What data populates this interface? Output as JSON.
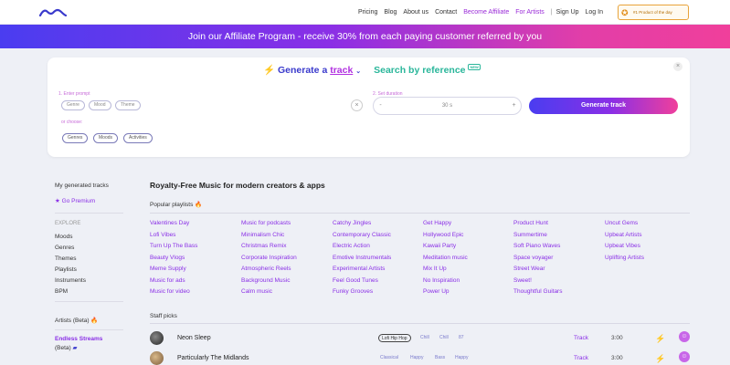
{
  "nav": {
    "links": [
      "Pricing",
      "Blog",
      "About us",
      "Contact",
      "Become Affiliate",
      "For Artists",
      "Sign Up",
      "Log In"
    ],
    "badge_text": "#1 Product of the day"
  },
  "banner": {
    "text": "Join our Affiliate Program - receive 30% from each paying customer referred by you"
  },
  "generator": {
    "tab_generate_prefix": "Generate a",
    "tab_generate_word": "track",
    "tab_reference": "Search by reference",
    "tab_reference_badge": "NEW",
    "label_prompt": "1. Enter prompt",
    "prompt_chips": [
      "Genre",
      "Mood",
      "Theme"
    ],
    "label_choose": "or choose:",
    "choose_chips": [
      "Genres",
      "Moods",
      "Activities"
    ],
    "label_duration": "2. Set duration",
    "duration_value": "30 s",
    "decrease": "-",
    "increase": "+",
    "generate_button": "Generate track",
    "close": "×"
  },
  "sidebar": {
    "my_tracks": "My generated tracks",
    "go_premium": "Go Premium",
    "explore": "EXPLORE",
    "explore_items": [
      "Moods",
      "Genres",
      "Themes",
      "Playlists",
      "Instruments",
      "BPM"
    ],
    "artists": "Artists (Beta)",
    "endless": "Endless Streams",
    "endless_sub": "(Beta)"
  },
  "main": {
    "title": "Royalty-Free Music for modern creators & apps",
    "popular": "Popular playlists",
    "playlists": [
      [
        "Valentines Day",
        "Lofi Vibes",
        "Turn Up The Bass",
        "Beauty Vlogs",
        "Meme Supply",
        "Music for ads",
        "Music for video"
      ],
      [
        "Music for podcasts",
        "Minimalism Chic",
        "Christmas Remix",
        "Corporate Inspiration",
        "Atmospheric Reels",
        "Background Music",
        "Calm music"
      ],
      [
        "Catchy Jingles",
        "Contemporary Classic",
        "Electric Action",
        "Emotive Instrumentals",
        "Experimental Artists",
        "Feel Good Tunes",
        "Funky Grooves"
      ],
      [
        "Get Happy",
        "Hollywood Epic",
        "Kawaii Party",
        "Meditation music",
        "Mix It Up",
        "No Inspiration",
        "Power Up"
      ],
      [
        "Product Hunt",
        "Summertime",
        "Soft Piano Waves",
        "Space voyager",
        "Street Wear",
        "Sweet!",
        "Thoughtful Guitars"
      ],
      [
        "Uncut Gems",
        "Upbeat Artists",
        "Upbeat Vibes",
        "Uplifting Artists"
      ]
    ],
    "staff": "Staff picks",
    "tracks": [
      {
        "name": "Neon Sleep",
        "tags": [
          "Lofi Hip Hop",
          "Chill",
          "Chill",
          "87"
        ],
        "type": "Track",
        "duration": "3:00"
      },
      {
        "name": "Particularly The Midlands",
        "tags": [
          "Classical",
          "Happy",
          "Bass",
          "Happy"
        ],
        "type": "Track",
        "duration": "3:00"
      }
    ]
  }
}
